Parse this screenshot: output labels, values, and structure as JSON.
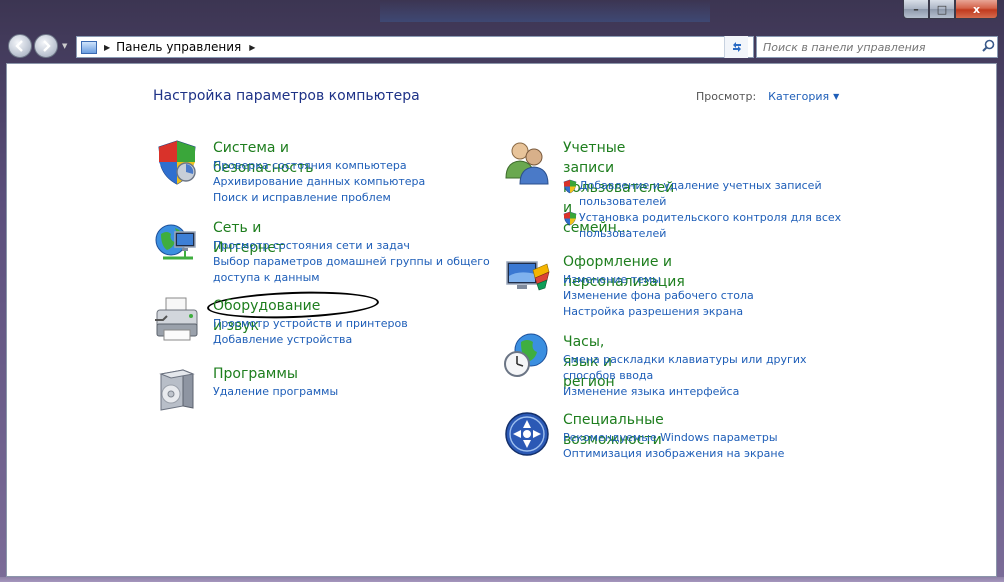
{
  "window": {
    "title": "Панель управления",
    "caption": {
      "minimize": "–",
      "maximize": "□",
      "close": "x"
    }
  },
  "nav": {
    "address": "Панель управления",
    "search_placeholder": "Поиск в панели управления"
  },
  "header": {
    "title": "Настройка параметров компьютера",
    "view_label": "Просмотр:",
    "view_value": "Категория"
  },
  "categories": [
    {
      "title": "Система и безопасность",
      "links": [
        "Проверка состояния компьютера",
        "Архивирование данных компьютера",
        "Поиск и исправление проблем"
      ]
    },
    {
      "title": "Сеть и Интернет",
      "links": [
        "Просмотр состояния сети и задач",
        "Выбор параметров домашней группы и общего",
        "доступа к данным"
      ]
    },
    {
      "title": "Оборудование и звук",
      "links": [
        "Просмотр устройств и принтеров",
        "Добавление устройства"
      ]
    },
    {
      "title": "Программы",
      "links": [
        "Удаление программы"
      ]
    },
    {
      "title_line1": "Учетные записи пользователей и",
      "title_line2": "семейн...",
      "links": [
        "Добавление и удаление учетных записей",
        "пользователей",
        "Установка родительского контроля для всех",
        "пользователей"
      ]
    },
    {
      "title": "Оформление и персонализация",
      "links": [
        "Изменение темы",
        "Изменение фона рабочего стола",
        "Настройка разрешения экрана"
      ]
    },
    {
      "title": "Часы, язык и регион",
      "links": [
        "Смена раскладки клавиатуры или других",
        "способов ввода",
        "Изменение языка интерфейса"
      ]
    },
    {
      "title": "Специальные возможности",
      "links": [
        "Рекомендуемые Windows параметры",
        "Оптимизация изображения на экране"
      ]
    }
  ]
}
